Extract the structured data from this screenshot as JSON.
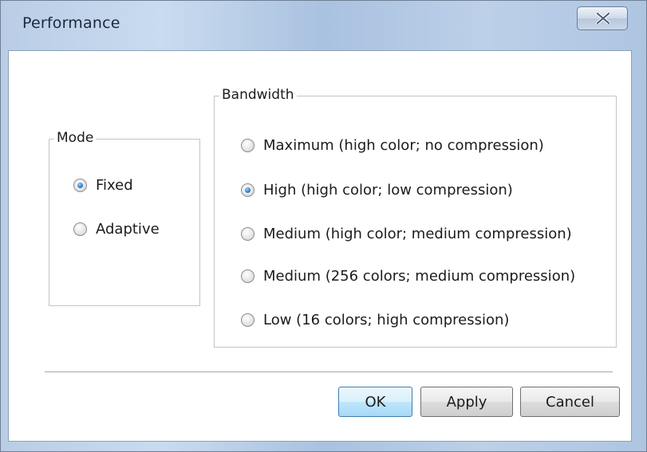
{
  "window": {
    "title": "Performance"
  },
  "mode": {
    "legend": "Mode",
    "options": [
      {
        "label": "Fixed",
        "checked": true
      },
      {
        "label": "Adaptive",
        "checked": false
      }
    ]
  },
  "bandwidth": {
    "legend": "Bandwidth",
    "options": [
      {
        "label": "Maximum (high color; no compression)",
        "checked": false
      },
      {
        "label": "High (high color; low compression)",
        "checked": true
      },
      {
        "label": "Medium (high color; medium compression)",
        "checked": false
      },
      {
        "label": "Medium (256 colors; medium compression)",
        "checked": false
      },
      {
        "label": "Low (16 colors; high compression)",
        "checked": false
      }
    ]
  },
  "buttons": {
    "ok": "OK",
    "apply": "Apply",
    "cancel": "Cancel"
  },
  "colors": {
    "title_gradient": "#b9cde6",
    "default_button": "#bee6fd",
    "radio_selected": "#2f7fd0"
  },
  "icons": {
    "close": "close-icon"
  }
}
